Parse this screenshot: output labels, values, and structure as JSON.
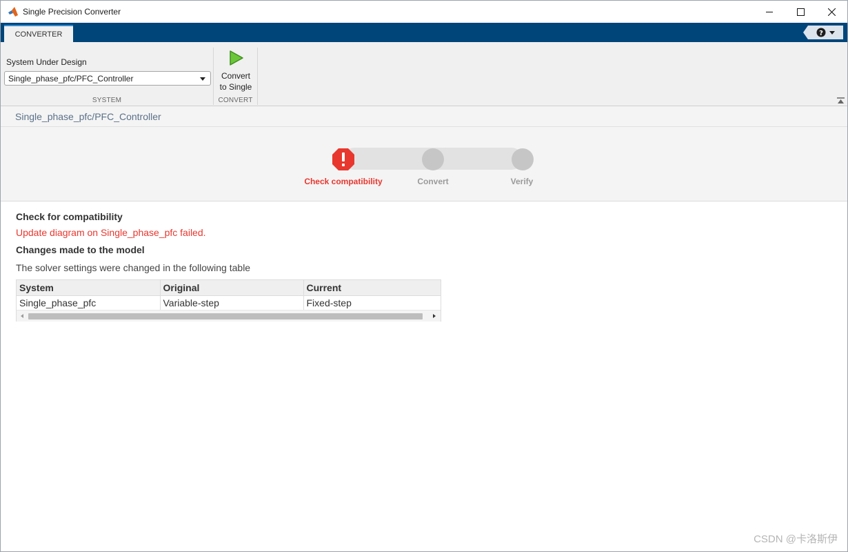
{
  "window": {
    "title": "Single Precision Converter",
    "controls": [
      "minimize-icon",
      "maximize-icon",
      "close-icon"
    ]
  },
  "ribbon": {
    "tab_label": "CONVERTER",
    "help_icon": "question-mark-icon"
  },
  "toolstrip": {
    "system_section": {
      "label": "System Under Design",
      "selected_system": "Single_phase_pfc/PFC_Controller",
      "section_title": "SYSTEM"
    },
    "convert_section": {
      "button_label_line1": "Convert",
      "button_label_line2": "to Single",
      "button_icon": "play-icon",
      "section_title": "CONVERT"
    }
  },
  "breadcrumb": "Single_phase_pfc/PFC_Controller",
  "steps": [
    {
      "label": "Check compatibility",
      "status": "error"
    },
    {
      "label": "Convert",
      "status": "pending"
    },
    {
      "label": "Verify",
      "status": "pending"
    }
  ],
  "content": {
    "check_heading": "Check for compatibility",
    "error_message": "Update diagram on Single_phase_pfc failed.",
    "changes_heading": "Changes made to the model",
    "changes_description": "The solver settings were changed in the following table",
    "table": {
      "columns": [
        "System",
        "Original",
        "Current"
      ],
      "rows": [
        [
          "Single_phase_pfc",
          "Variable-step",
          "Fixed-step"
        ]
      ]
    }
  },
  "watermark": "CSDN @卡洛斯伊",
  "colors": {
    "ribbon_blue": "#00457a",
    "error_red": "#e8372e",
    "play_green": "#5fbf2a",
    "path_text": "#5b7089"
  }
}
